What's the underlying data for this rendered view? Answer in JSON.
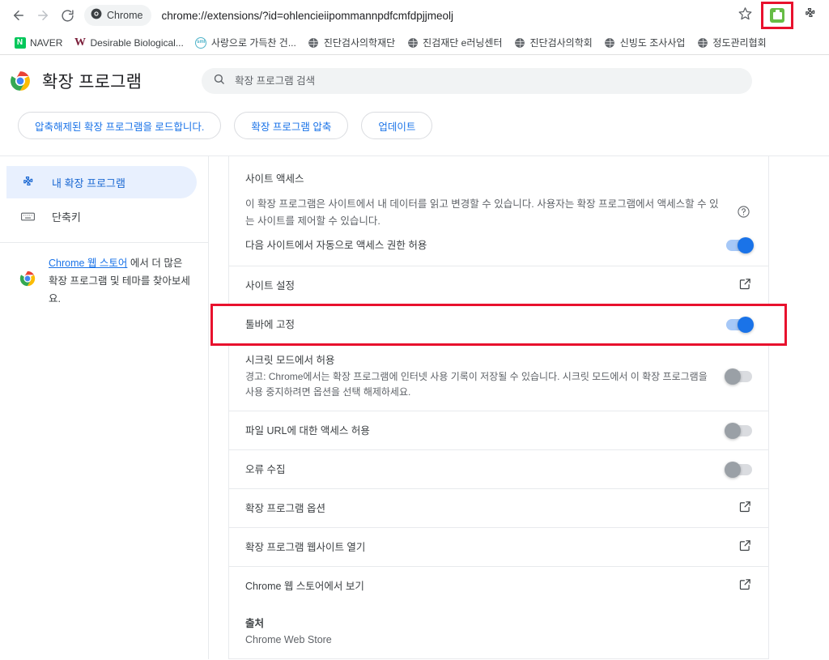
{
  "browser": {
    "nav": {
      "back": "back-arrow",
      "forward": "forward-arrow",
      "reload": "reload"
    },
    "origin_chip_label": "Chrome",
    "url": "chrome://extensions/?id=ohlencieiipommannpdfcmfdpjjmeolj",
    "right_icons": {
      "bookmark_star": "star",
      "highlighted_extension": "green-extension",
      "extensions_puzzle": "puzzle"
    },
    "highlight_color": "#e8112d"
  },
  "bookmarks": [
    {
      "label": "NAVER",
      "favicon": "naver-icon"
    },
    {
      "label": "Desirable Biological...",
      "favicon": "w-letter-icon"
    },
    {
      "label": "사랑으로 가득찬 건...",
      "favicon": "sml-icon"
    },
    {
      "label": "진단검사의학재단",
      "favicon": "globe-icon"
    },
    {
      "label": "진검재단 e러닝센터",
      "favicon": "globe-icon"
    },
    {
      "label": "진단검사의학회",
      "favicon": "globe-icon"
    },
    {
      "label": "신빙도 조사사업",
      "favicon": "globe-icon"
    },
    {
      "label": "정도관리협회",
      "favicon": "globe-icon"
    }
  ],
  "extensions_page": {
    "title": "확장 프로그램",
    "search_placeholder": "확장 프로그램 검색",
    "search_value": "",
    "actions": [
      "압축해제된 확장 프로그램을 로드합니다.",
      "확장 프로그램 압축",
      "업데이트"
    ],
    "sidebar": {
      "items": [
        {
          "label": "내 확장 프로그램",
          "icon": "puzzle-icon",
          "active": true
        },
        {
          "label": "단축키",
          "icon": "keyboard-icon",
          "active": false
        }
      ],
      "webstore": {
        "link_text": "Chrome 웹 스토어",
        "rest_text": " 에서 더 많은 확장 프로그램 및 테마를 찾아보세요."
      }
    },
    "detail": {
      "site_access": {
        "heading": "사이트 액세스",
        "description": "이 확장 프로그램은 사이트에서 내 데이터를 읽고 변경할 수 있습니다. 사용자는 확장 프로그램에서 액세스할 수 있는 사이트를 제어할 수 있습니다.",
        "help_icon": "help-circle-icon",
        "auto_access_label": "다음 사이트에서 자동으로 액세스 권한 허용",
        "auto_access_toggle": "on"
      },
      "rows": [
        {
          "label": "사이트 설정",
          "control": "external-link",
          "highlighted": false
        },
        {
          "label": "툴바에 고정",
          "control": "toggle",
          "state": "on",
          "highlighted": true
        },
        {
          "label": "시크릿 모드에서 허용",
          "sub": "경고: Chrome에서는 확장 프로그램에 인터넷 사용 기록이 저장될 수 있습니다. 시크릿 모드에서 이 확장 프로그램을 사용 중지하려면 옵션을 선택 해제하세요.",
          "control": "toggle",
          "state": "off",
          "highlighted": false
        },
        {
          "label": "파일 URL에 대한 액세스 허용",
          "control": "toggle",
          "state": "off",
          "highlighted": false
        },
        {
          "label": "오류 수집",
          "control": "toggle",
          "state": "off",
          "highlighted": false
        },
        {
          "label": "확장 프로그램 옵션",
          "control": "external-link",
          "highlighted": false
        },
        {
          "label": "확장 프로그램 웹사이트 열기",
          "control": "external-link",
          "highlighted": false
        },
        {
          "label": "Chrome 웹 스토어에서 보기",
          "control": "external-link",
          "highlighted": false
        }
      ],
      "source": {
        "title": "출처",
        "value": "Chrome Web Store"
      }
    }
  },
  "colors": {
    "accent_blue": "#1a73e8",
    "highlight_red": "#e8112d",
    "sidebar_active_bg": "#e8f0fe",
    "naver_green": "#03c75a",
    "ext_icon_green": "#67bc45"
  }
}
